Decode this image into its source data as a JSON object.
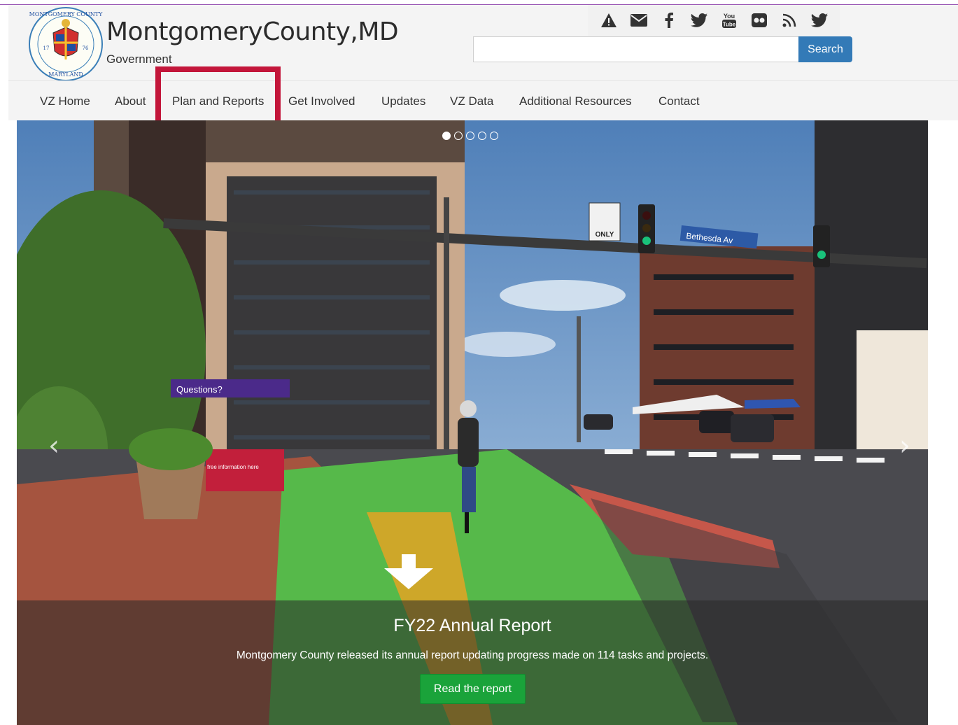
{
  "header": {
    "brand_name": "MontgomeryCounty,MD",
    "brand_sub": "Government",
    "seal_text_top": "MONTGOMERY COUNTY",
    "seal_text_bottom": "MARYLAND",
    "seal_left": "17",
    "seal_right": "76"
  },
  "social_icons": [
    "alert-icon",
    "email-icon",
    "facebook-icon",
    "twitter-icon",
    "youtube-icon",
    "flickr-icon",
    "rss-icon",
    "twitter-icon"
  ],
  "search": {
    "value": "",
    "placeholder": "",
    "button_label": "Search"
  },
  "nav": {
    "items": [
      {
        "label": "VZ Home"
      },
      {
        "label": "About"
      },
      {
        "label": "Plan and Reports"
      },
      {
        "label": "Get Involved"
      },
      {
        "label": "Updates"
      },
      {
        "label": "VZ Data"
      },
      {
        "label": "Additional Resources"
      },
      {
        "label": "Contact"
      }
    ],
    "highlighted_item": "Plan and Reports",
    "highlight_color": "#c3163a"
  },
  "carousel": {
    "slide_count": 5,
    "active_slide": 1,
    "caption_title": "FY22 Annual Report",
    "caption_text": "Montgomery County released its annual report updating progress made on 114 tasks and projects.",
    "button_label": "Read the report",
    "button_color": "#1aa33a",
    "scene_signs": {
      "questions": "Questions?",
      "street": "Bethesda Av",
      "only": "ONLY",
      "info": "free information here"
    }
  },
  "colors": {
    "search_button": "#337ab7",
    "header_bg": "#f4f4f4"
  }
}
